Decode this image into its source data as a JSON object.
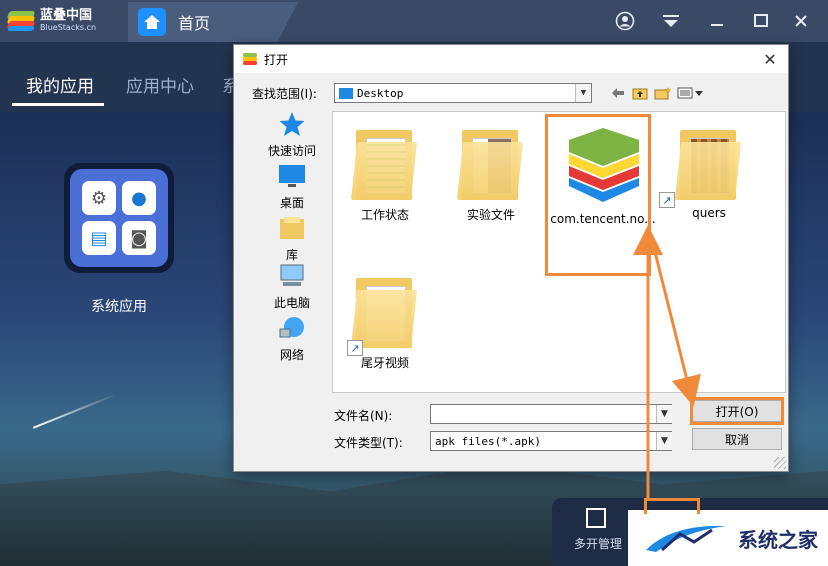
{
  "app": {
    "brand_title": "蓝叠中国",
    "brand_sub": "BlueStacks.cn",
    "home_tab": "首页"
  },
  "nav": {
    "items": [
      {
        "label": "我的应用",
        "active": true
      },
      {
        "label": "应用中心",
        "active": false
      },
      {
        "label": "系",
        "active": false
      }
    ]
  },
  "desktop": {
    "sys_app_label": "系统应用",
    "dock_label": "多开管理"
  },
  "watermark": {
    "text": "系统之家"
  },
  "dialog": {
    "title": "打开",
    "lookin_label": "查找范围(I):",
    "lookin_value": "Desktop",
    "places": [
      {
        "label": "快速访问",
        "icon": "star-icon"
      },
      {
        "label": "桌面",
        "icon": "desktop-icon"
      },
      {
        "label": "库",
        "icon": "library-icon"
      },
      {
        "label": "此电脑",
        "icon": "computer-icon"
      },
      {
        "label": "网络",
        "icon": "network-icon"
      }
    ],
    "files": [
      {
        "label": "工作状态",
        "type": "folder"
      },
      {
        "label": "实验文件",
        "type": "folder"
      },
      {
        "label": "com.tencent.no...",
        "type": "apk",
        "selected": true
      },
      {
        "label": "quers",
        "type": "folder-shortcut"
      },
      {
        "label": "尾牙视频",
        "type": "folder-shortcut"
      }
    ],
    "filename_label": "文件名(N):",
    "filename_value": "",
    "filetype_label": "文件类型(T):",
    "filetype_value": "apk files(*.apk)",
    "open_button": "打开(O)",
    "cancel_button": "取消"
  },
  "colors": {
    "highlight": "#f08a3a",
    "accent": "#1e90ff"
  }
}
